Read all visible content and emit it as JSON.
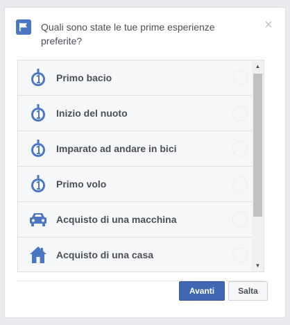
{
  "dialog": {
    "question": "Quali sono state le tue prime esperienze preferite?",
    "close_symbol": "×"
  },
  "items": [
    {
      "label": "Primo bacio",
      "icon": "medal-icon"
    },
    {
      "label": "Inizio del nuoto",
      "icon": "medal-icon"
    },
    {
      "label": "Imparato ad andare in bici",
      "icon": "medal-icon"
    },
    {
      "label": "Primo volo",
      "icon": "medal-icon"
    },
    {
      "label": "Acquisto di una macchina",
      "icon": "car-icon"
    },
    {
      "label": "Acquisto di una casa",
      "icon": "house-icon"
    }
  ],
  "buttons": {
    "primary_label": "Avanti",
    "secondary_label": "Salta"
  },
  "scrollbar": {
    "up": "▲",
    "down": "▼"
  },
  "colors": {
    "accent": "#4267b2",
    "icon": "#4a76c2",
    "text": "#4b4f56",
    "background": "#e9ebee"
  }
}
